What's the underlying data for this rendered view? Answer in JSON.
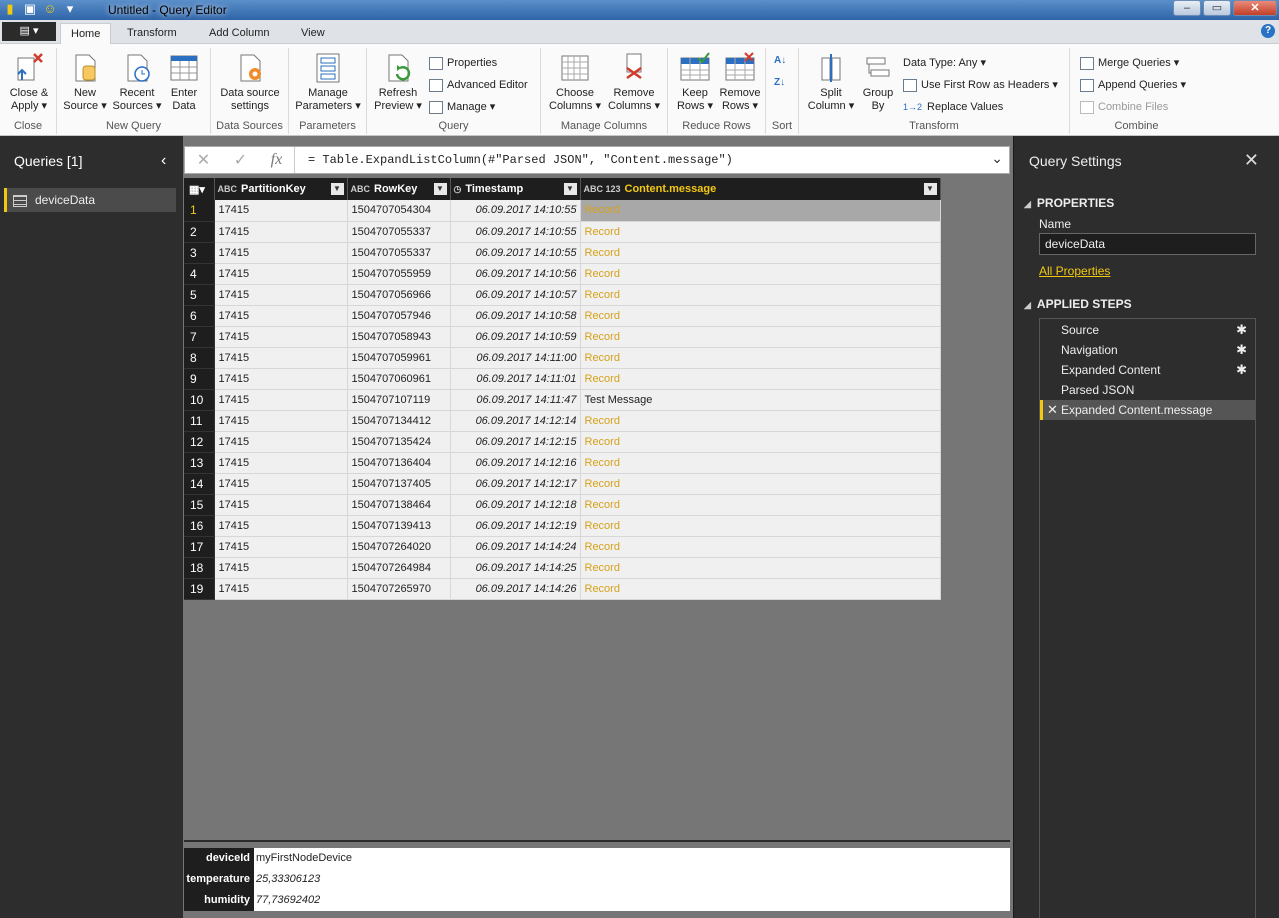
{
  "window": {
    "title": "Untitled - Query Editor",
    "min": "–",
    "max": "▭",
    "close": "✕"
  },
  "tabs": {
    "file": "▤ ▾",
    "home": "Home",
    "transform": "Transform",
    "add_column": "Add Column",
    "view": "View",
    "help": "?"
  },
  "ribbon": {
    "close": {
      "btn": "Close &\nApply ▾",
      "label": "Close"
    },
    "new_query": {
      "new_source": "New\nSource ▾",
      "recent_sources": "Recent\nSources ▾",
      "enter_data": "Enter\nData",
      "label": "New Query"
    },
    "data_sources": {
      "settings": "Data source\nsettings",
      "label": "Data Sources"
    },
    "parameters": {
      "manage": "Manage\nParameters ▾",
      "label": "Parameters"
    },
    "query": {
      "refresh": "Refresh\nPreview ▾",
      "properties": "Properties",
      "advanced_editor": "Advanced Editor",
      "manage": "Manage ▾",
      "label": "Query"
    },
    "manage_columns": {
      "choose": "Choose\nColumns ▾",
      "remove": "Remove\nColumns ▾",
      "label": "Manage Columns"
    },
    "reduce_rows": {
      "keep": "Keep\nRows ▾",
      "remove": "Remove\nRows ▾",
      "label": "Reduce Rows"
    },
    "sort": {
      "label": "Sort"
    },
    "transform": {
      "split": "Split\nColumn ▾",
      "group_by": "Group\nBy",
      "data_type": "Data Type: Any ▾",
      "first_row": "Use First Row as Headers ▾",
      "replace": "Replace Values",
      "label": "Transform"
    },
    "combine": {
      "merge": "Merge Queries ▾",
      "append": "Append Queries ▾",
      "combine_files": "Combine Files",
      "label": "Combine"
    }
  },
  "queries": {
    "header": "Queries [1]",
    "items": [
      "deviceData"
    ]
  },
  "formula": "= Table.ExpandListColumn(#\"Parsed JSON\", \"Content.message\")",
  "grid": {
    "headers": [
      {
        "type": "ABC",
        "name": "PartitionKey"
      },
      {
        "type": "ABC",
        "name": "RowKey"
      },
      {
        "type": "◷",
        "name": "Timestamp"
      },
      {
        "type": "ABC 123",
        "name": "Content.message"
      }
    ],
    "rows": [
      [
        "1",
        "17415",
        "1504707054304",
        "06.09.2017 14:10:55",
        "Record"
      ],
      [
        "2",
        "17415",
        "1504707055337",
        "06.09.2017 14:10:55",
        "Record"
      ],
      [
        "3",
        "17415",
        "1504707055337",
        "06.09.2017 14:10:55",
        "Record"
      ],
      [
        "4",
        "17415",
        "1504707055959",
        "06.09.2017 14:10:56",
        "Record"
      ],
      [
        "5",
        "17415",
        "1504707056966",
        "06.09.2017 14:10:57",
        "Record"
      ],
      [
        "6",
        "17415",
        "1504707057946",
        "06.09.2017 14:10:58",
        "Record"
      ],
      [
        "7",
        "17415",
        "1504707058943",
        "06.09.2017 14:10:59",
        "Record"
      ],
      [
        "8",
        "17415",
        "1504707059961",
        "06.09.2017 14:11:00",
        "Record"
      ],
      [
        "9",
        "17415",
        "1504707060961",
        "06.09.2017 14:11:01",
        "Record"
      ],
      [
        "10",
        "17415",
        "1504707107119",
        "06.09.2017 14:11:47",
        "Test Message"
      ],
      [
        "11",
        "17415",
        "1504707134412",
        "06.09.2017 14:12:14",
        "Record"
      ],
      [
        "12",
        "17415",
        "1504707135424",
        "06.09.2017 14:12:15",
        "Record"
      ],
      [
        "13",
        "17415",
        "1504707136404",
        "06.09.2017 14:12:16",
        "Record"
      ],
      [
        "14",
        "17415",
        "1504707137405",
        "06.09.2017 14:12:17",
        "Record"
      ],
      [
        "15",
        "17415",
        "1504707138464",
        "06.09.2017 14:12:18",
        "Record"
      ],
      [
        "16",
        "17415",
        "1504707139413",
        "06.09.2017 14:12:19",
        "Record"
      ],
      [
        "17",
        "17415",
        "1504707264020",
        "06.09.2017 14:14:24",
        "Record"
      ],
      [
        "18",
        "17415",
        "1504707264984",
        "06.09.2017 14:14:25",
        "Record"
      ],
      [
        "19",
        "17415",
        "1504707265970",
        "06.09.2017 14:14:26",
        "Record"
      ]
    ]
  },
  "detail": [
    {
      "key": "deviceId",
      "value": "myFirstNodeDevice"
    },
    {
      "key": "temperature",
      "value": "25,33306123"
    },
    {
      "key": "humidity",
      "value": "77,73692402"
    }
  ],
  "settings": {
    "title": "Query Settings",
    "properties": "PROPERTIES",
    "name_label": "Name",
    "name_value": "deviceData",
    "all_properties": "All Properties",
    "applied_steps": "APPLIED STEPS",
    "steps": [
      {
        "name": "Source",
        "gear": true
      },
      {
        "name": "Navigation",
        "gear": true
      },
      {
        "name": "Expanded Content",
        "gear": true
      },
      {
        "name": "Parsed JSON",
        "gear": false
      },
      {
        "name": "Expanded Content.message",
        "gear": false
      }
    ]
  },
  "colors": {
    "accent": "#f2c811",
    "record": "#d6a21b"
  }
}
